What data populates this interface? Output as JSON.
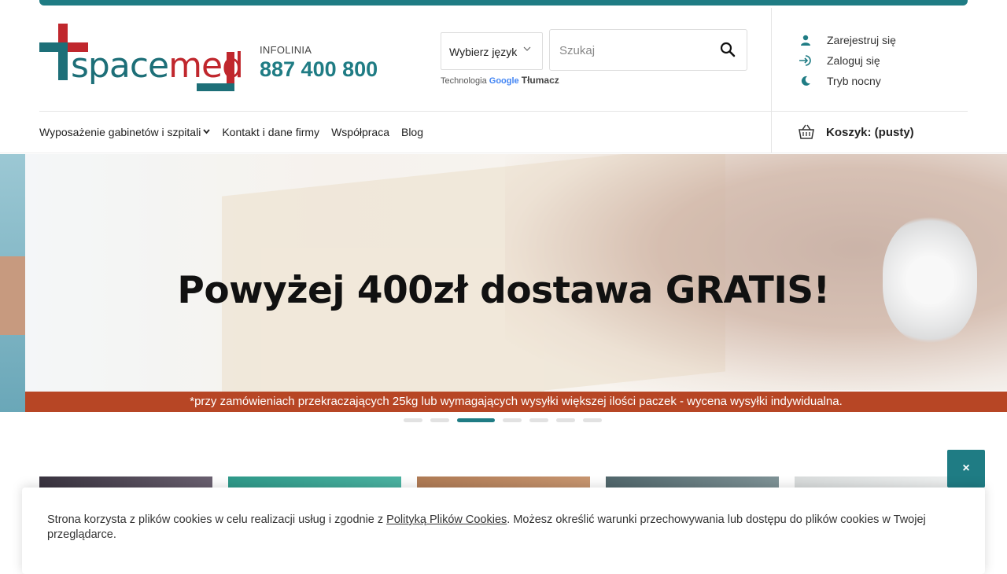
{
  "header": {
    "logo": {
      "text_part1": "space",
      "text_part2": "med"
    },
    "infoline": {
      "label": "INFOLINIA",
      "phone": "887 400 800"
    },
    "language": {
      "label": "Wybierz język"
    },
    "translate": {
      "prefix": "Technologia",
      "brand": "Google",
      "suffix": "Tłumacz"
    },
    "search": {
      "placeholder": "Szukaj"
    },
    "account": {
      "register": "Zarejestruj się",
      "login": "Zaloguj się",
      "night_mode": "Tryb nocny"
    },
    "cart": {
      "label": "Koszyk: (pusty)"
    },
    "colors": {
      "accent": "#1f7c84",
      "brand_red": "#c0272d",
      "note_bar": "#b74625"
    }
  },
  "nav": {
    "items": [
      {
        "label": "Wyposażenie gabinetów i szpitali",
        "has_dropdown": true
      },
      {
        "label": "Kontakt i dane firmy"
      },
      {
        "label": "Współpraca"
      },
      {
        "label": "Blog"
      }
    ]
  },
  "banner": {
    "headline": "Powyżej 400zł dostawa GRATIS!",
    "note": "*przy zamówieniach przekraczających 25kg lub wymagających wysyłki większej ilości paczek - wycena wysyłki indywidualna.",
    "slide_count": 7,
    "active_slide": 3
  },
  "cookie": {
    "text_before": "Strona korzysta z plików cookies w celu realizacji usług i zgodnie z ",
    "link": "Polityką Plików Cookies",
    "text_after": ". Możesz określić warunki przechowywania lub dostępu do plików cookies w Twojej przeglądarce.",
    "close_label": "×"
  }
}
